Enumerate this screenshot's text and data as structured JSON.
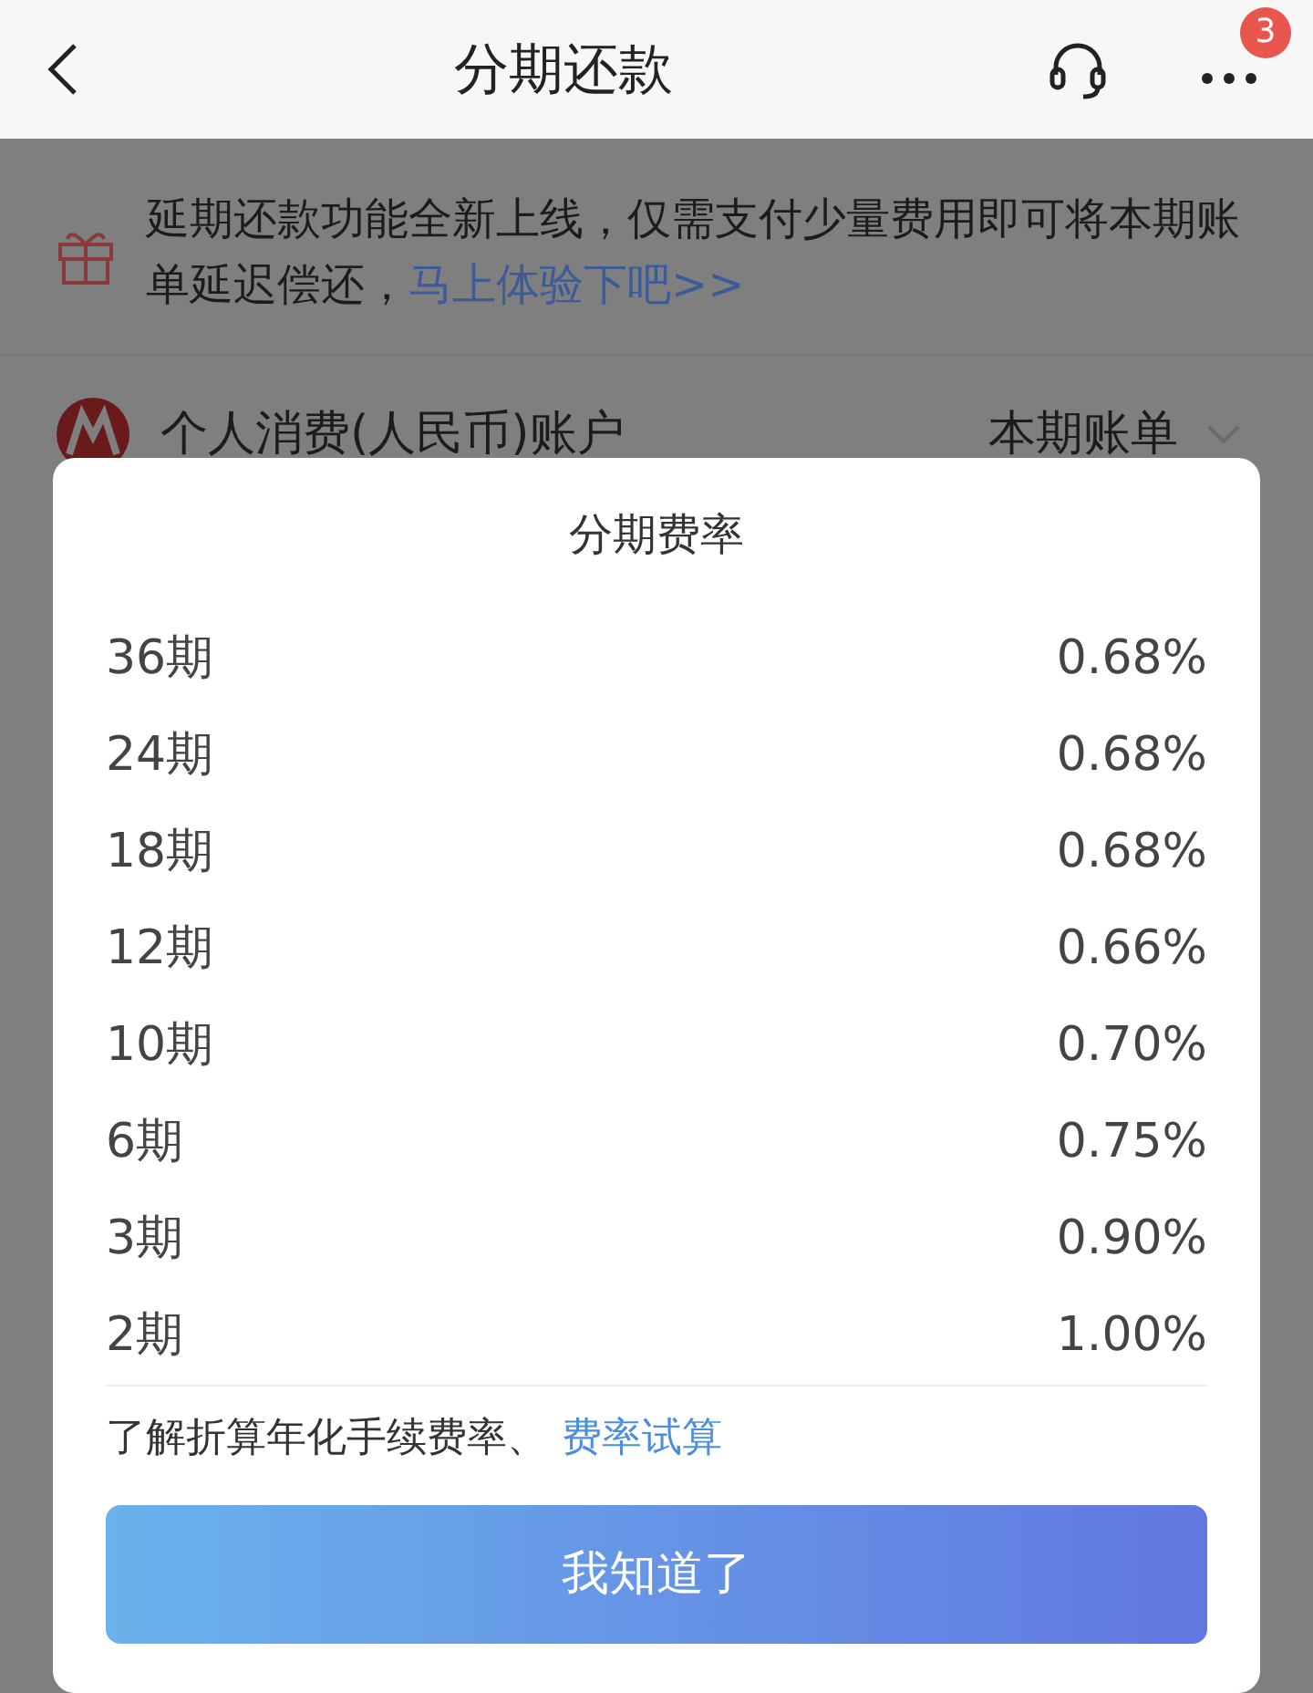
{
  "header": {
    "title": "分期还款",
    "badge": "3"
  },
  "banner": {
    "text": "延期还款功能全新上线，仅需支付少量费用即可将本期账单延迟偿还，",
    "link": "马上体验下吧>>"
  },
  "account": {
    "name": "个人消费(人民币)账户",
    "bill": "本期账单"
  },
  "modal": {
    "title": "分期费率",
    "rates": [
      {
        "term": "36期",
        "rate": "0.68%"
      },
      {
        "term": "24期",
        "rate": "0.68%"
      },
      {
        "term": "18期",
        "rate": "0.68%"
      },
      {
        "term": "12期",
        "rate": "0.66%"
      },
      {
        "term": "10期",
        "rate": "0.70%"
      },
      {
        "term": "6期",
        "rate": "0.75%"
      },
      {
        "term": "3期",
        "rate": "0.90%"
      },
      {
        "term": "2期",
        "rate": "1.00%"
      }
    ],
    "note": "了解折算年化手续费率、",
    "note_link": "费率试算",
    "button": "我知道了"
  }
}
